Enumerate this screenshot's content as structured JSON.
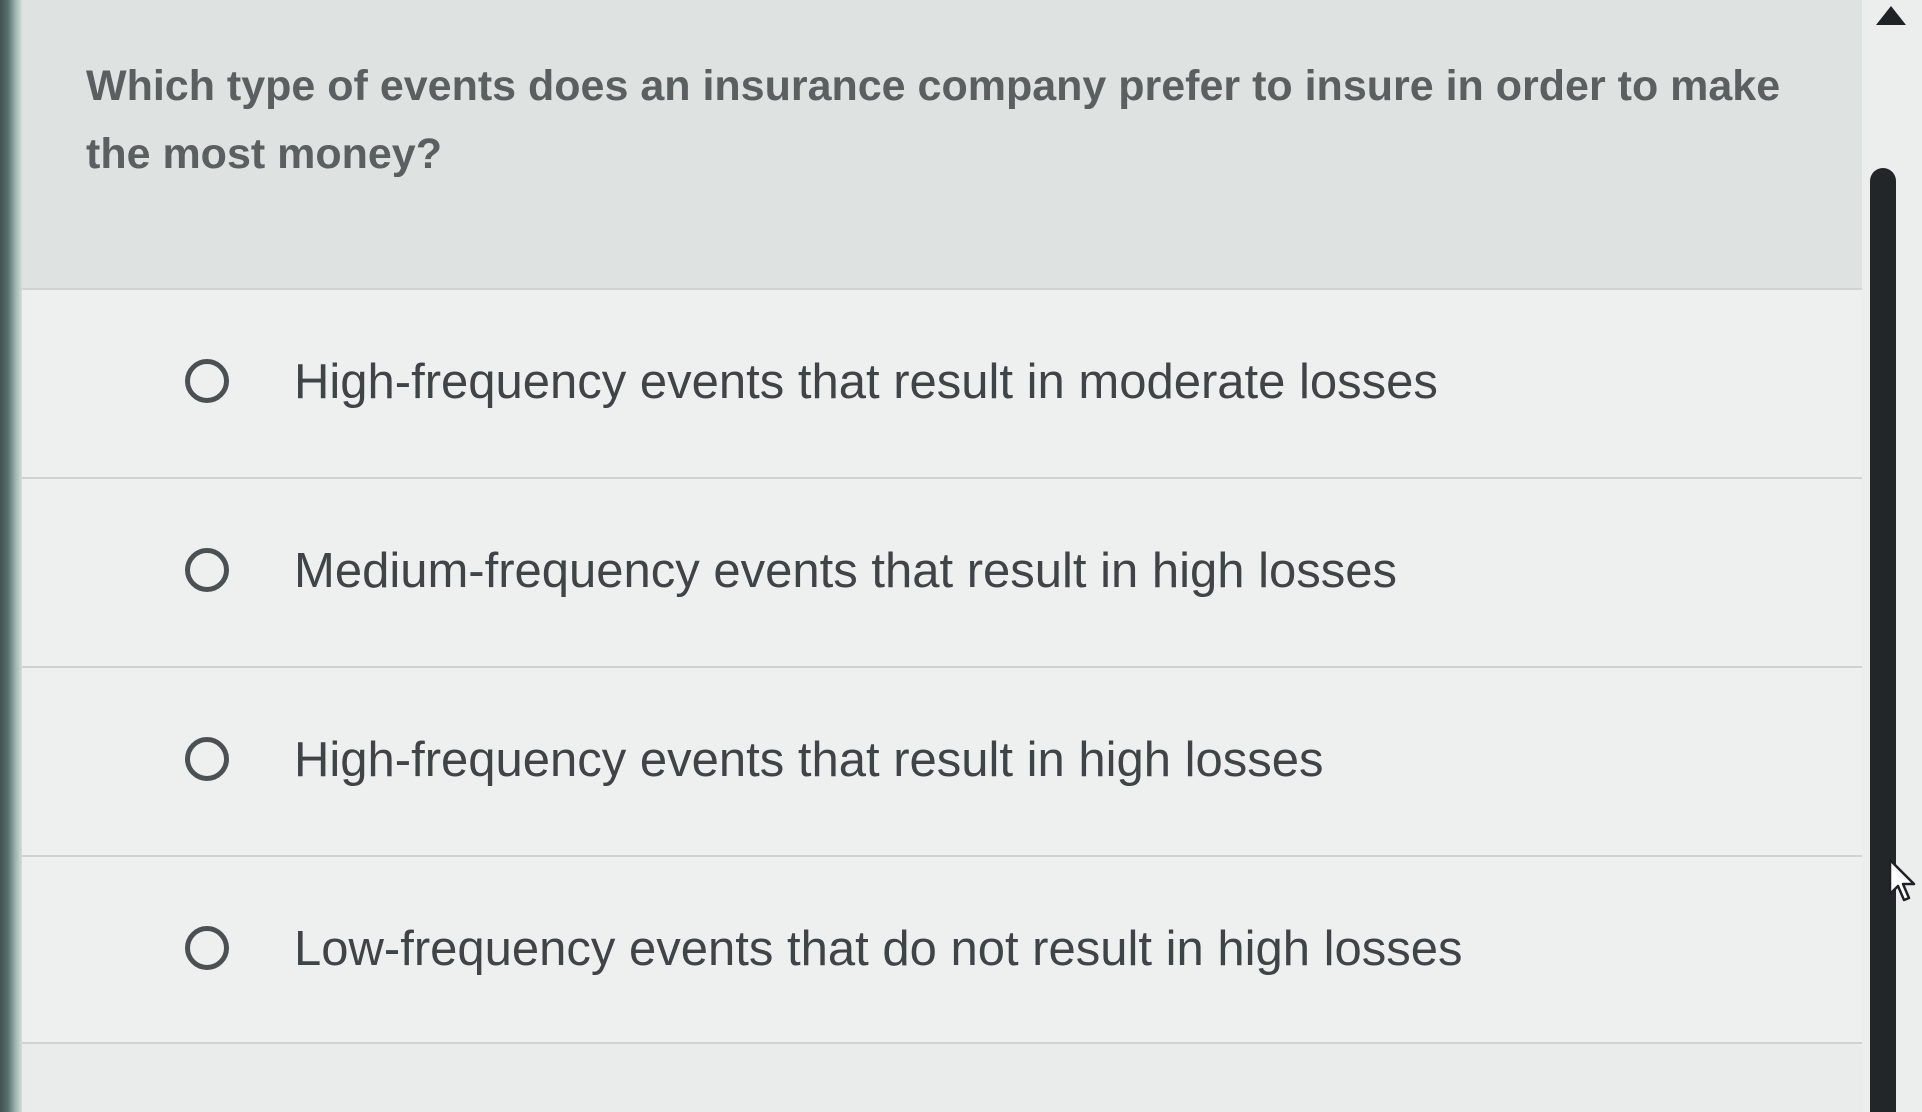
{
  "question": {
    "text": "Which type of events does an insurance company prefer to insure in order to make the most money?"
  },
  "options": [
    {
      "label": "High-frequency events that result in moderate losses",
      "selected": false
    },
    {
      "label": "Medium-frequency events that result in high losses",
      "selected": false
    },
    {
      "label": "High-frequency events that result in high losses",
      "selected": false
    },
    {
      "label": "Low-frequency events that do not result in high losses",
      "selected": false
    }
  ],
  "icons": {
    "radio": "radio-unselected-icon",
    "scroll_up": "triangle-up-icon",
    "cursor": "pointer-cursor-icon"
  },
  "colors": {
    "question_text": "#5a5f60",
    "option_text": "#3f4446",
    "radio_ring": "#4b5052",
    "scroll_thumb": "#232628"
  }
}
